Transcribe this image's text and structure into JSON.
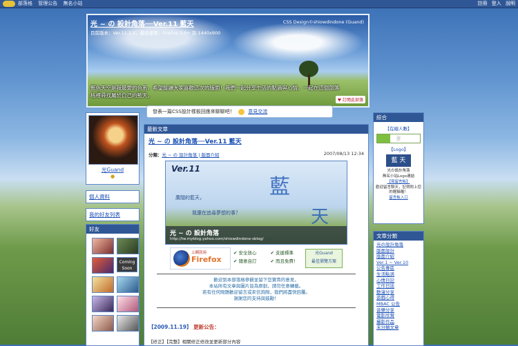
{
  "topbar": {
    "links": [
      "部落格",
      "管理公告",
      "無名小站"
    ],
    "right": [
      "註冊",
      "登入",
      "說明"
    ]
  },
  "banner": {
    "title": "光 ~ の 設計角落──Ver.11 藍天",
    "subtitle": "目前版本：Ver.11.1.2，最佳瀏覽：FireFox 3.0+ 及 1440x900",
    "credit": "CSS Design©shiowdindone (Guand)",
    "description": "藍色天空是我最愛的色系，希望能讓大家喜歡這次的版面！我們一起分享生活的點滴與心情，一起在這個部落格裡尋找屬於自己的藍天。",
    "subscribe": "訂閱此部落"
  },
  "notice": {
    "text": "發表一篇CSS設計樣板回應來聊聊吧！",
    "link": "意見交流"
  },
  "left": {
    "username": "光Guand",
    "links": [
      "個人資料",
      "我的好友列表"
    ],
    "friends_title": "好友",
    "thumb_label": "Coming Soon"
  },
  "main": {
    "header": "最新文章",
    "post_title": "光 ~ の 設計角落──Ver.11 藍天",
    "category_label": "分類：",
    "category": "光 ~ の 設計角落 | 版面介紹",
    "date": "2007/08/13 12:34",
    "hero": {
      "ver": "Ver.11",
      "k1": "藍",
      "k2": "天",
      "line1": "廣闊的藍天，",
      "line2": "我還在追尋夢想的事？",
      "name": "光 ~ の 設計角落",
      "url": "http://tw.myblog.yahoo.com/shiowdindone-sblog/"
    },
    "firefox_top": "上網就用",
    "firefox_brand": "Firefox",
    "checks": [
      "安全放心",
      "隨意自訂",
      "支援標準",
      "而且免費！"
    ],
    "badge_name": "光Guand",
    "badge_sub": "最佳瀏覽方案",
    "center_text": [
      "歡迎到本部落格參觀並留下您寶貴的意見，",
      "本站所有文章與圖片皆為原創，請勿任意轉載。",
      "若有任何問題歡迎留言或來信詢問，我們將盡快回覆。",
      "謝謝您的支持與鼓勵！"
    ],
    "update_date": "【2009.11.19】",
    "update_label": "更新公告：",
    "update_text": "【修正】【完整】相關修正修改並更新部分內容"
  },
  "right": {
    "title": "綜合",
    "online_label": "【在線人數】",
    "online_count": "2",
    "online_fill": 0.3,
    "logo_label": "【Logo】",
    "logo_text": "藍 天",
    "small1": "光の設計角落",
    "small2": "無名小站Logo連結",
    "small3": "【寫留言板】",
    "small4": "歡迎留言聊天，記得附上您的暱稱喔！",
    "small5": "留言板入口",
    "cats_title": "文章分類",
    "cats": [
      "光の設計角落",
      "版面設計",
      "版面介紹",
      "Ver.1 ~ Ver.10",
      "公告專區",
      "生活點滴",
      "心情日記",
      "工作日誌",
      "動漫分享",
      "遊戲心得",
      "MBAC 公告",
      "音樂分享",
      "電影欣賞",
      "攝影作品",
      "未分類文章"
    ]
  }
}
